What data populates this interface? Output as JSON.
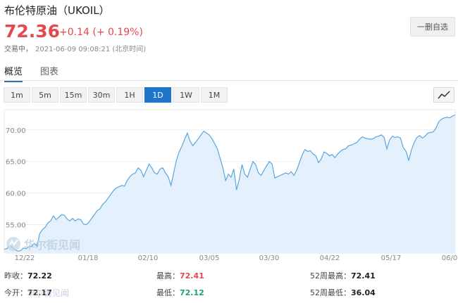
{
  "header": {
    "title": "布伦特原油（UKOIL）",
    "price": "72.36",
    "change": "+0.14 (+ 0.19%)",
    "status": "交易中，",
    "timestamp": "2021-06-09 09:08:21 (北京时间)",
    "remove_button": "一删自选"
  },
  "tabs": [
    {
      "label": "概览",
      "active": true
    },
    {
      "label": "图表",
      "active": false
    }
  ],
  "timeframes": [
    {
      "label": "1m",
      "active": false
    },
    {
      "label": "5m",
      "active": false
    },
    {
      "label": "15m",
      "active": false
    },
    {
      "label": "30m",
      "active": false
    },
    {
      "label": "1H",
      "active": false
    },
    {
      "label": "1D",
      "active": true
    },
    {
      "label": "1W",
      "active": false
    },
    {
      "label": "1M",
      "active": false
    }
  ],
  "chart_type_icon": "line-chart-icon",
  "colors": {
    "up": "#e5484d",
    "down": "#1fa36a",
    "accent": "#1e75c9",
    "line": "#5aa6e0",
    "fill": "#e4f1fc"
  },
  "chart_data": {
    "type": "area",
    "x_ticks": [
      "12/22",
      "01/18",
      "02/10",
      "03/05",
      "03/30",
      "04/22",
      "05/17",
      "06/0"
    ],
    "y_ticks": [
      55.0,
      60.0,
      65.0,
      70.0
    ],
    "y_tick_labels": [
      "55.00",
      "60.00",
      "65.00",
      "70.00"
    ],
    "ylim": [
      50.5,
      73.2
    ],
    "values": [
      51.1,
      51.2,
      51.8,
      51.4,
      51.0,
      50.8,
      50.9,
      51.3,
      51.2,
      51.5,
      51.6,
      52.0,
      51.6,
      53.6,
      54.2,
      54.6,
      55.3,
      55.6,
      56.4,
      55.8,
      56.2,
      56.6,
      56.5,
      55.9,
      55.6,
      56.0,
      55.6,
      55.9,
      55.8,
      55.1,
      55.0,
      55.4,
      56.0,
      56.6,
      57.2,
      57.5,
      58.2,
      58.6,
      59.2,
      59.8,
      60.4,
      60.8,
      61.0,
      61.2,
      61.1,
      62.0,
      62.6,
      63.0,
      63.2,
      64.0,
      63.6,
      62.6,
      63.6,
      64.6,
      64.0,
      63.2,
      63.0,
      63.8,
      64.0,
      63.2,
      62.6,
      61.2,
      63.2,
      65.2,
      66.5,
      67.4,
      68.5,
      69.5,
      68.2,
      67.5,
      68.0,
      68.6,
      69.2,
      69.8,
      69.5,
      69.2,
      68.6,
      67.8,
      67.0,
      65.5,
      64.0,
      62.0,
      63.0,
      62.5,
      63.8,
      60.5,
      62.2,
      64.5,
      63.0,
      62.5,
      63.8,
      65.0,
      64.5,
      63.2,
      62.8,
      63.6,
      64.3,
      65.0,
      64.6,
      62.4,
      62.6,
      62.8,
      63.0,
      63.2,
      63.0,
      63.4,
      62.8,
      63.6,
      64.8,
      66.0,
      66.9,
      66.6,
      66.7,
      66.2,
      65.9,
      64.8,
      65.4,
      66.5,
      66.3,
      65.9,
      66.1,
      65.6,
      66.2,
      66.6,
      66.9,
      67.0,
      67.5,
      67.6,
      67.8,
      68.0,
      68.5,
      68.9,
      68.7,
      68.6,
      68.5,
      68.6,
      68.9,
      69.0,
      69.2,
      68.8,
      67.0,
      68.4,
      69.0,
      68.8,
      68.9,
      68.7,
      67.2,
      66.6,
      65.2,
      66.8,
      68.0,
      68.8,
      69.1,
      68.7,
      69.0,
      69.5,
      69.6,
      69.7,
      70.3,
      71.3,
      71.7,
      71.9,
      72.0,
      71.9,
      72.2,
      72.36
    ]
  },
  "stats": {
    "prev_close_label": "昨收：",
    "prev_close_value": "72.22",
    "high_label": "最高：",
    "high_value": "72.41",
    "high52_label": "52周最高：",
    "high52_value": "72.41",
    "open_label": "今开：",
    "open_value": "72.17",
    "low_label": "最低：",
    "low_value": "72.12",
    "low52_label": "52周最低：",
    "low52_value": "36.04"
  },
  "watermark": {
    "text": "华尔街见闻",
    "text2": "华尔街见闻"
  }
}
